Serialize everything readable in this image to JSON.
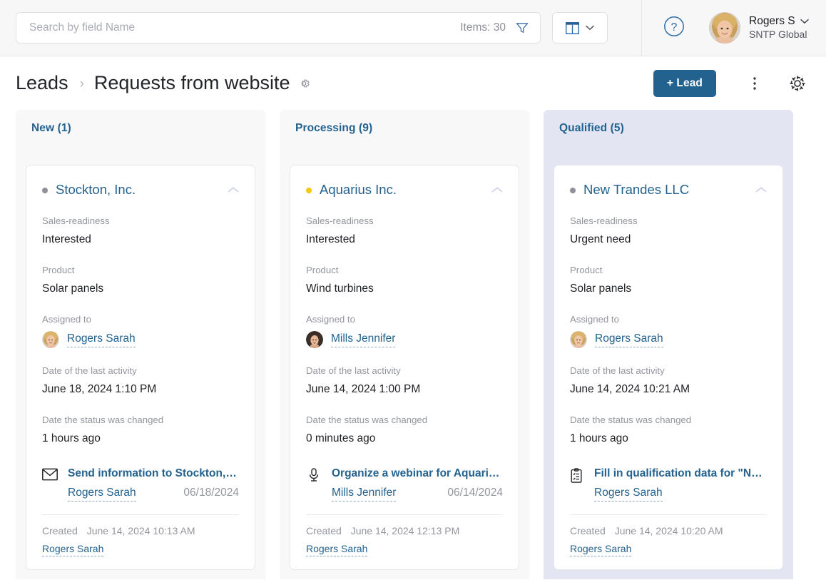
{
  "topbar": {
    "search": {
      "placeholder": "Search by field Name",
      "value": ""
    },
    "items_count_label": "Items: 30",
    "filter_icon": "funnel-icon",
    "view_icon": "kanban-view-icon",
    "view_chevron_icon": "chevron-down-icon",
    "help_icon": "question-circle-icon",
    "user": {
      "name": "Rogers S",
      "org": "SNTP Global",
      "avatar_icon": "user-avatar-photo",
      "chevron_icon": "chevron-down-icon"
    }
  },
  "title_row": {
    "breadcrumb_parent": "Leads",
    "breadcrumb_separator": "›",
    "breadcrumb_current": "Requests from website",
    "title_gear_icon": "gear-icon",
    "add_lead_label": "+ Lead",
    "more_icon": "kebab-menu-icon",
    "settings_icon": "gear-icon"
  },
  "colors": {
    "accent_blue": "#23628f",
    "link_blue": "#23628f",
    "highlight_column_bg": "#e3e5f2",
    "plain_column_bg": "#f8f8f9",
    "dot_gray": "#8e9199",
    "dot_yellow": "#f5c518"
  },
  "labels": {
    "sales_readiness": "Sales-readiness",
    "product": "Product",
    "assigned_to": "Assigned to",
    "last_activity": "Date of the last activity",
    "status_changed": "Date the status was changed",
    "created": "Created"
  },
  "columns": [
    {
      "title": "New (1)",
      "highlighted": false,
      "card": {
        "company": "Stockton, Inc.",
        "dot_color": "#8e9199",
        "sales_readiness": "Interested",
        "product": "Solar panels",
        "assignee": "Rogers Sarah",
        "assignee_avatar": "blonde-woman-photo",
        "last_activity": "June 18, 2024 1:10 PM",
        "status_changed": "1 hours ago",
        "task": {
          "icon": "envelope-icon",
          "title": "Send information to Stockton, Inc.",
          "person": "Rogers Sarah",
          "date": "06/18/2024"
        },
        "created_date": "June 14, 2024 10:13 AM",
        "created_by": "Rogers Sarah"
      }
    },
    {
      "title": "Processing (9)",
      "highlighted": false,
      "card": {
        "company": "Aquarius Inc.",
        "dot_color": "#f5c518",
        "sales_readiness": "Interested",
        "product": "Wind turbines",
        "assignee": "Mills Jennifer",
        "assignee_avatar": "brunette-woman-photo",
        "last_activity": "June 14, 2024 1:00 PM",
        "status_changed": "0 minutes ago",
        "task": {
          "icon": "microphone-icon",
          "title": "Organize a webinar for Aquarius Inc.",
          "person": "Mills Jennifer",
          "date": "06/14/2024"
        },
        "created_date": "June 14, 2024 12:13 PM",
        "created_by": "Rogers Sarah"
      }
    },
    {
      "title": "Qualified (5)",
      "highlighted": true,
      "card": {
        "company": "New Trandes LLC",
        "dot_color": "#8e9199",
        "sales_readiness": "Urgent need",
        "product": "Solar panels",
        "assignee": "Rogers Sarah",
        "assignee_avatar": "blonde-woman-photo",
        "last_activity": "June 14, 2024 10:21 AM",
        "status_changed": "1 hours ago",
        "task": {
          "icon": "clipboard-checklist-icon",
          "title": "Fill in qualification data for \"New Tra…",
          "person": "Rogers Sarah",
          "date": ""
        },
        "created_date": "June 14, 2024 10:20 AM",
        "created_by": "Rogers Sarah"
      }
    }
  ]
}
